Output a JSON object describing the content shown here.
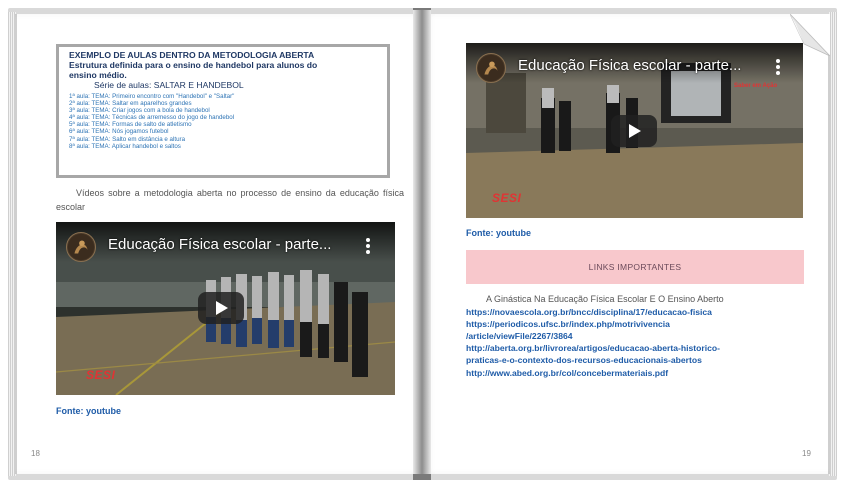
{
  "left_page": {
    "method_box": {
      "title": "EXEMPLO DE AULAS DENTRO DA METODOLOGIA ABERTA",
      "subtitle_line1": "Estrutura definida para o ensino de handebol para alunos do",
      "subtitle_line2": "ensino médio.",
      "series": "Série de aulas: SALTAR E HANDEBOL",
      "lessons": [
        "1ª aula: TEMA: Primeiro encontro com \"Handebol\" e \"Saltar\"",
        "2ª aula: TEMA: Saltar em aparelhos grandes",
        "3ª aula: TEMA: Criar jogos com a bola de handebol",
        "4ª aula: TEMA: Técnicas de arremesso do jogo de handebol",
        "5ª aula: TEMA: Formas de salto de atletismo",
        "6ª aula: TEMA: Nós jogamos futebol",
        "7ª aula: TEMA: Salto em distância e altura",
        "8ª aula: TEMA: Aplicar handebol e saltos"
      ]
    },
    "videos_intro": "Vídeos sobre a metodologia aberta no processo de ensino da educação física escolar",
    "video": {
      "title": "Educação Física escolar - parte...",
      "logo": "SESI"
    },
    "source": "Fonte: youtube",
    "page_number": "18"
  },
  "right_page": {
    "video": {
      "title": "Educação Física escolar - parte...",
      "logo": "SESI",
      "overlay_text": "Saber em Ação"
    },
    "source": "Fonte: youtube",
    "banner": "LINKS IMPORTANTES",
    "links_heading": "A Ginástica Na Educação Física Escolar E O Ensino Aberto",
    "links": [
      "https://novaescola.org.br/bncc/disciplina/17/educacao-fisica",
      "https://periodicos.ufsc.br/index.php/motrivivencia",
      "/article/viewFile/2267/3864",
      "http://aberta.org.br/livrorea/artigos/educacao-aberta-historico-",
      "praticas-e-o-contexto-dos-recursos-educacionais-abertos",
      "http://www.abed.org.br/col/concebermateriais.pdf"
    ],
    "page_number": "19"
  },
  "colors": {
    "heading_blue": "#1f3864",
    "lesson_blue": "#2e74b5",
    "link_blue": "#1f5ca8",
    "banner_pink": "#f8c8cc",
    "sesi_red": "#e03434"
  },
  "icons": [
    "play-icon",
    "more-vertical-icon",
    "channel-avatar-icon",
    "page-curl-icon"
  ]
}
